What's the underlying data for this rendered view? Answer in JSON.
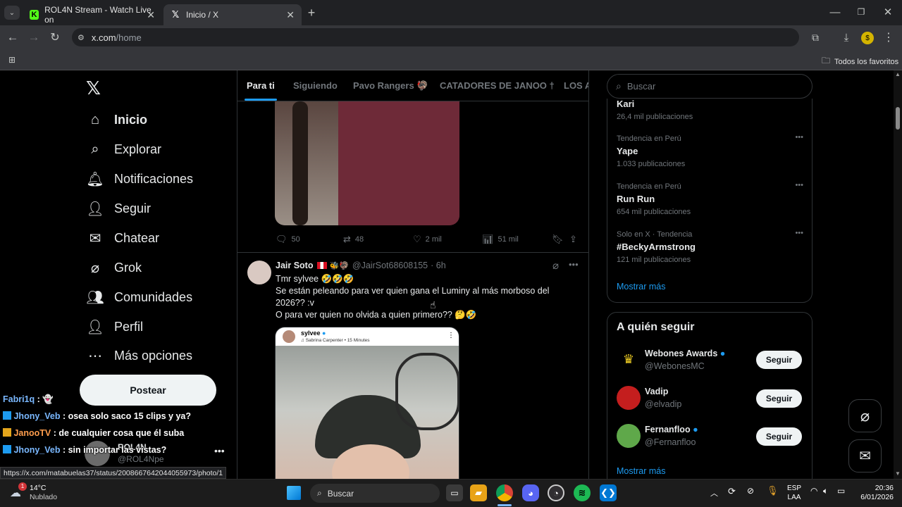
{
  "browser": {
    "tabs": [
      {
        "title": "ROL4N Stream - Watch Live on"
      },
      {
        "title": "Inicio / X"
      }
    ],
    "url": {
      "host": "x.com",
      "path": "/home"
    },
    "bookmarks_label": "Todos los favoritos",
    "status_url": "https://x.com/matabuelas37/status/2008667642044055973/photo/1"
  },
  "nav": {
    "items": [
      {
        "label": "Inicio",
        "icon": "home-icon"
      },
      {
        "label": "Explorar",
        "icon": "search-icon"
      },
      {
        "label": "Notificaciones",
        "icon": "bell-icon"
      },
      {
        "label": "Seguir",
        "icon": "add-person-icon"
      },
      {
        "label": "Chatear",
        "icon": "mail-icon"
      },
      {
        "label": "Grok",
        "icon": "grok-icon"
      },
      {
        "label": "Comunidades",
        "icon": "people-icon"
      },
      {
        "label": "Perfil",
        "icon": "person-icon"
      },
      {
        "label": "Más opciones",
        "icon": "more-circle-icon"
      }
    ],
    "post_button": "Postear",
    "account": {
      "name": "ROL4N",
      "handle": "@ROL4Npe"
    }
  },
  "chat": [
    {
      "user": "Fabri1q",
      "text": ""
    },
    {
      "user": "Jhony_Veb",
      "text": "osea solo saco 15 clips y ya?"
    },
    {
      "user": "JanooTV",
      "text": "de cualquier cosa que él suba"
    },
    {
      "user": "Jhony_Veb",
      "text": "sin importar las vistas?"
    }
  ],
  "feed": {
    "tabs": [
      "Para ti",
      "Siguiendo",
      "Pavo Rangers",
      "CATADORES DE JANOO †",
      "LOS A"
    ],
    "first_post_actions": {
      "replies": "50",
      "reposts": "48",
      "likes": "2 mil",
      "views": "51 mil"
    },
    "post": {
      "author": "Jair Soto",
      "handle": "@JairSot68608155",
      "time": "· 6h",
      "line1": "Tmr sylvee 🤣🤣🤣",
      "line2": "Se están peleando para ver quien gana el Luminy al más morboso del 2026?? :v",
      "line3": "O para ver quien no olvida a quien primero?? 🤔🤣",
      "embed": {
        "name": "sylvee",
        "song": "Sabrina Carpenter • 15 Minutes"
      }
    }
  },
  "right": {
    "search_placeholder": "Buscar",
    "trends": [
      {
        "category": "",
        "name": "Kari",
        "count": "26,4 mil publicaciones"
      },
      {
        "category": "Tendencia en Perú",
        "name": "Yape",
        "count": "1.033 publicaciones"
      },
      {
        "category": "Tendencia en Perú",
        "name": "Run Run",
        "count": "654 mil publicaciones"
      },
      {
        "category": "Solo en X · Tendencia",
        "name": "#BeckyArmstrong",
        "count": "121 mil publicaciones"
      }
    ],
    "show_more": "Mostrar más",
    "who_to_follow": {
      "title": "A quién seguir",
      "accounts": [
        {
          "name": "Webones Awards",
          "handle": "@WebonesMC",
          "verified": true,
          "button": "Seguir"
        },
        {
          "name": "Vadip",
          "handle": "@elvadip",
          "verified": false,
          "button": "Seguir"
        },
        {
          "name": "Fernanfloo",
          "handle": "@Fernanfloo",
          "verified": true,
          "button": "Seguir"
        }
      ],
      "show_more": "Mostrar más"
    }
  },
  "taskbar": {
    "weather": {
      "temp": "14°C",
      "desc": "Nublado",
      "badge": "1"
    },
    "search_label": "Buscar",
    "language": {
      "lang": "ESP",
      "layout": "LAA"
    },
    "clock": {
      "time": "20:36",
      "date": "6/01/2026"
    }
  },
  "colors": {
    "accent": "#1d9bf0",
    "background": "#000000",
    "chrome": "#35363a"
  }
}
